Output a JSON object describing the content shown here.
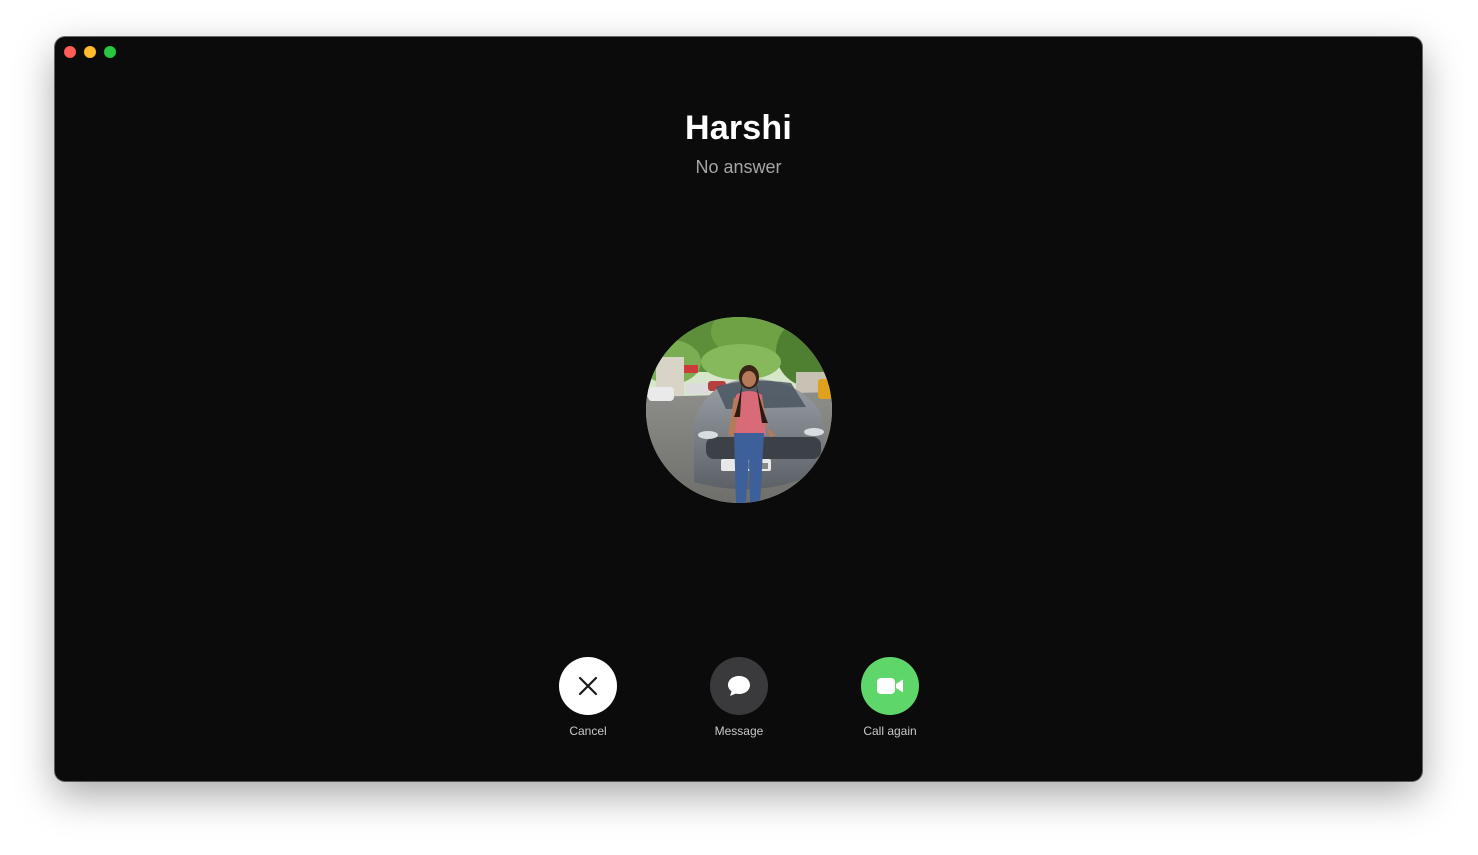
{
  "call": {
    "caller_name": "Harshi",
    "status": "No answer"
  },
  "window_controls": [
    "close",
    "minimize",
    "maximize"
  ],
  "avatar": {
    "description_icon": "contact-photo"
  },
  "actions": {
    "cancel": {
      "label": "Cancel",
      "icon": "close-icon"
    },
    "message": {
      "label": "Message",
      "icon": "message-bubble-icon"
    },
    "call_again": {
      "label": "Call again",
      "icon": "video-camera-icon"
    }
  },
  "colors": {
    "background": "#0b0b0b",
    "call_again": "#5fd669",
    "message": "#3a3a3c",
    "cancel": "#ffffff",
    "status_text": "#a6a6a6"
  }
}
